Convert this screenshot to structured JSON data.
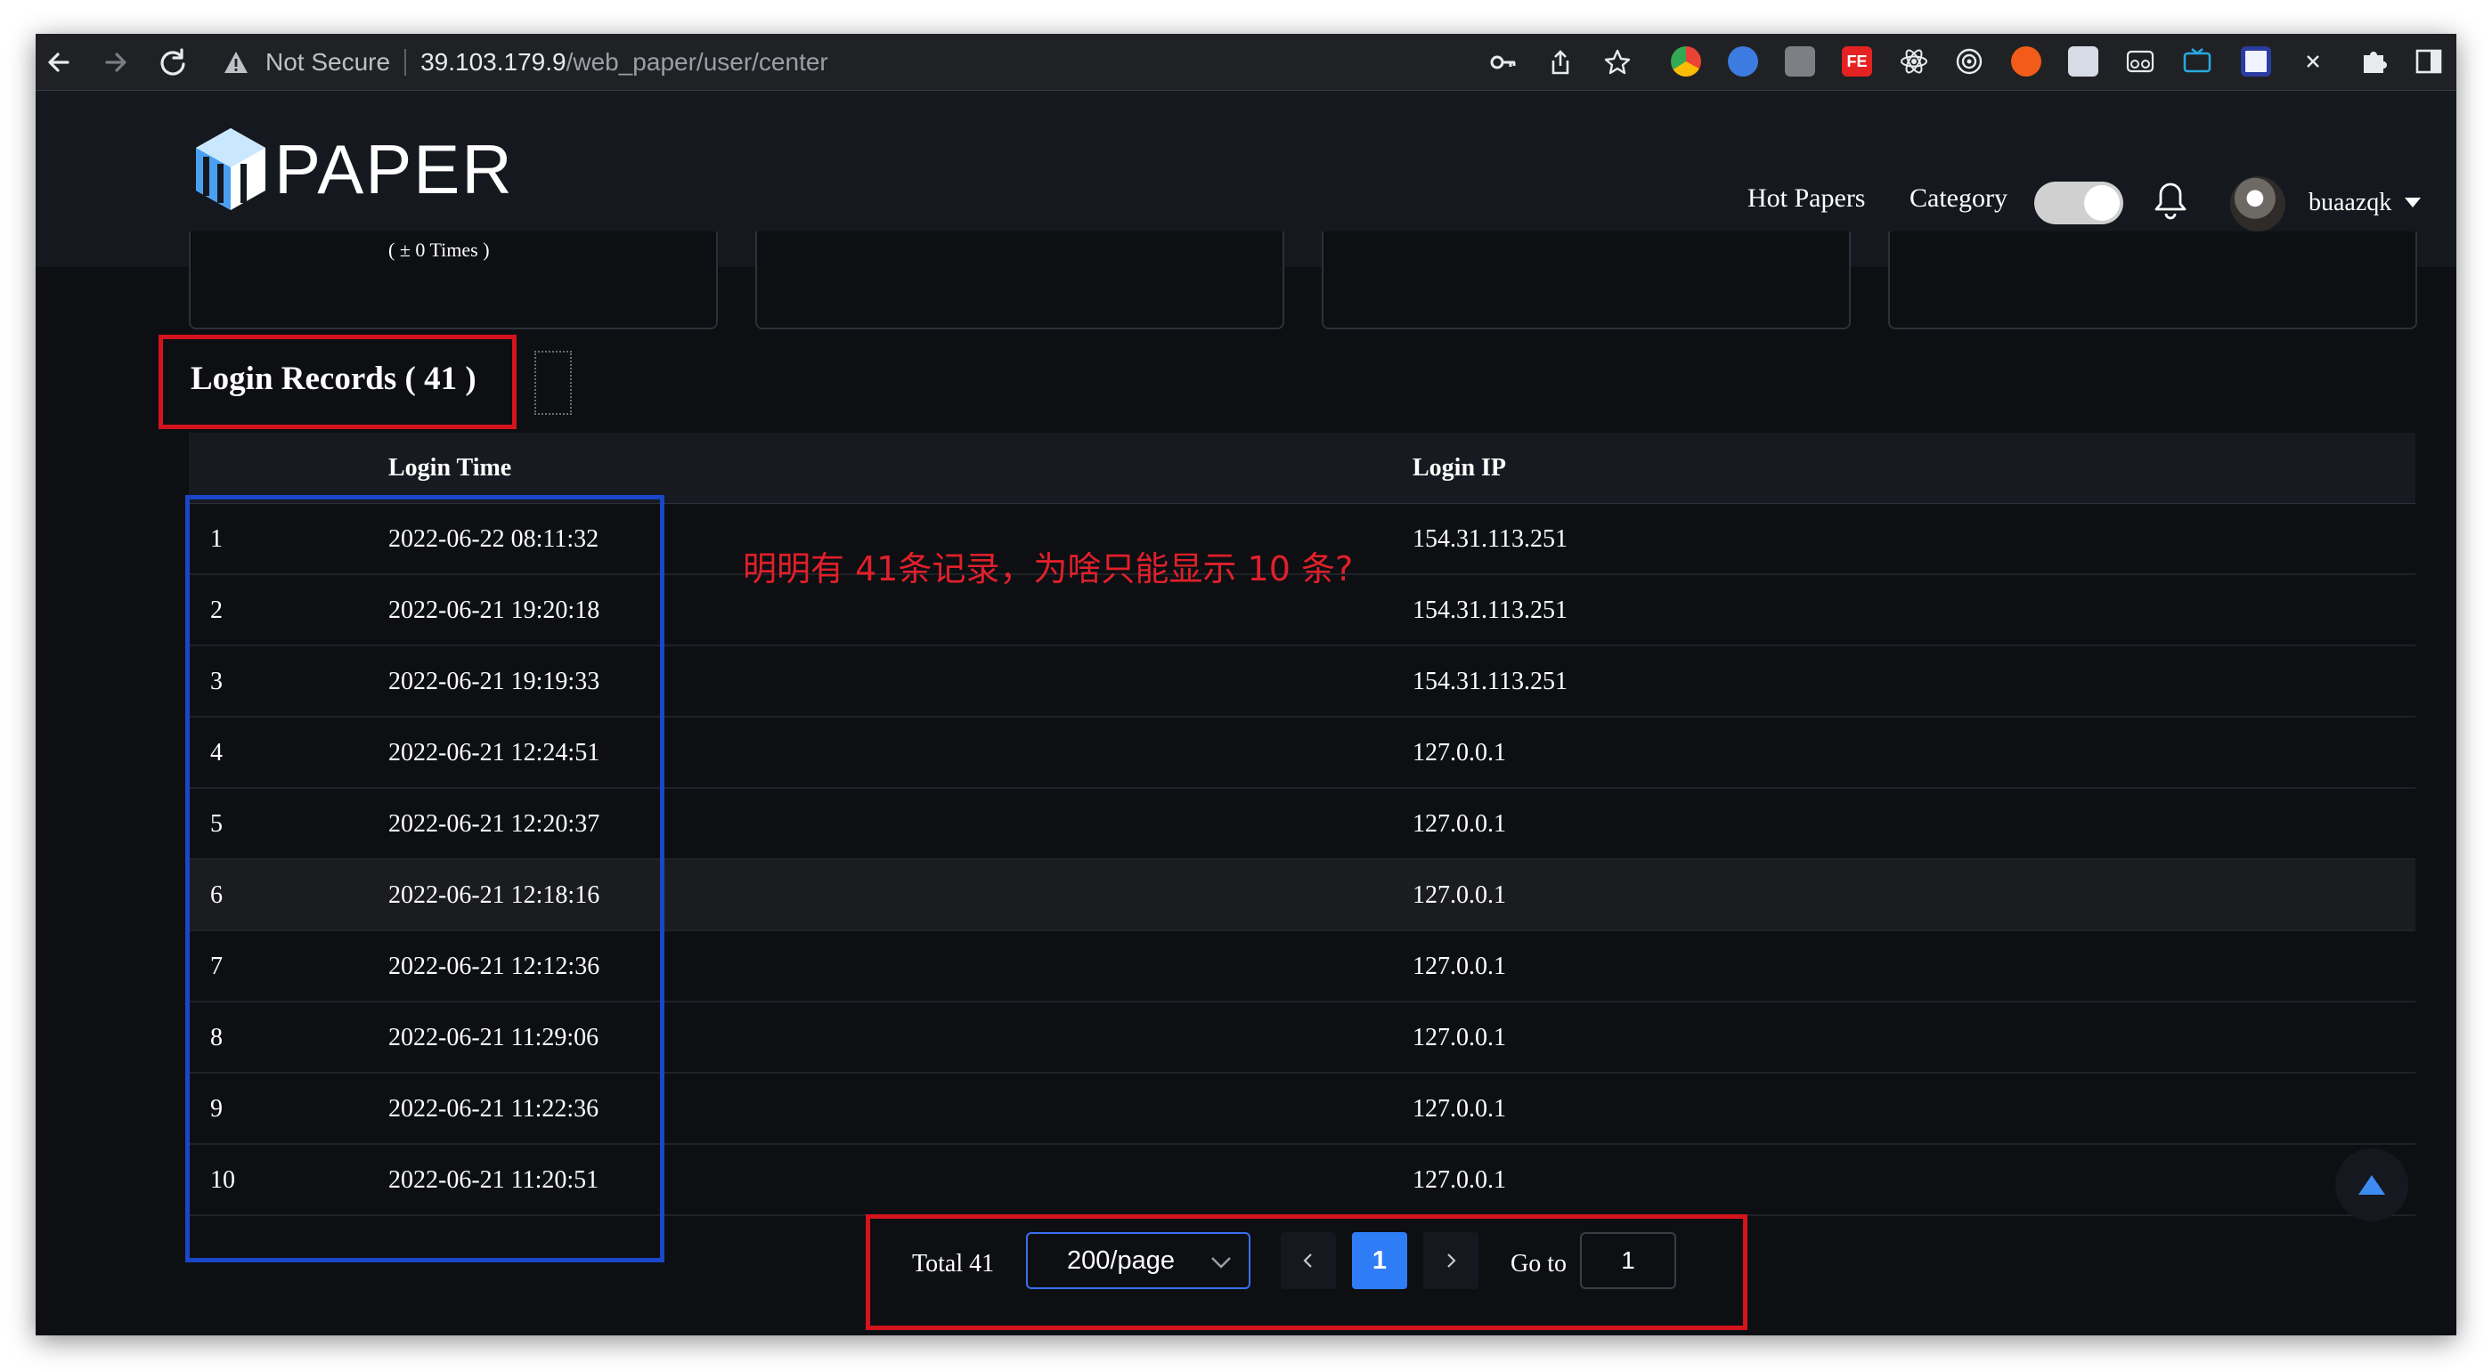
{
  "browser": {
    "security_label": "Not Secure",
    "url_host": "39.103.179.9",
    "url_path": "/web_paper/user/center",
    "extensions": [
      "chrome-icon",
      "cloud-icon",
      "doc-icon",
      "fe-icon",
      "react-icon",
      "target-icon",
      "infinity-icon",
      "window-icon",
      "glasses-icon",
      "tv-icon",
      "dict-icon",
      "x-icon",
      "puzzle-icon",
      "sidebar-icon"
    ]
  },
  "header": {
    "logo_text": "PAPER",
    "nav": {
      "hot_papers": "Hot Papers",
      "category": "Category"
    },
    "theme_toggle_on": true,
    "username": "buaazqk"
  },
  "stats": {
    "card1_text": "( ± 0 Times )"
  },
  "section": {
    "title": "Login Records ( 41 )"
  },
  "table": {
    "columns": {
      "time": "Login Time",
      "ip": "Login IP"
    },
    "rows": [
      {
        "idx": "1",
        "time": "2022-06-22 08:11:32",
        "ip": "154.31.113.251"
      },
      {
        "idx": "2",
        "time": "2022-06-21 19:20:18",
        "ip": "154.31.113.251"
      },
      {
        "idx": "3",
        "time": "2022-06-21 19:19:33",
        "ip": "154.31.113.251"
      },
      {
        "idx": "4",
        "time": "2022-06-21 12:24:51",
        "ip": "127.0.0.1"
      },
      {
        "idx": "5",
        "time": "2022-06-21 12:20:37",
        "ip": "127.0.0.1"
      },
      {
        "idx": "6",
        "time": "2022-06-21 12:18:16",
        "ip": "127.0.0.1"
      },
      {
        "idx": "7",
        "time": "2022-06-21 12:12:36",
        "ip": "127.0.0.1"
      },
      {
        "idx": "8",
        "time": "2022-06-21 11:29:06",
        "ip": "127.0.0.1"
      },
      {
        "idx": "9",
        "time": "2022-06-21 11:22:36",
        "ip": "127.0.0.1"
      },
      {
        "idx": "10",
        "time": "2022-06-21 11:20:51",
        "ip": "127.0.0.1"
      }
    ]
  },
  "annotation": {
    "text": "明明有 41条记录，为啥只能显示 10 条?"
  },
  "pagination": {
    "total": "Total 41",
    "page_size": "200/page",
    "current_page": "1",
    "goto_label": "Go to",
    "goto_value": "1"
  },
  "colors": {
    "accent": "#2f7df6",
    "highlight_red": "#d4141c",
    "highlight_blue": "#1a47c9"
  }
}
